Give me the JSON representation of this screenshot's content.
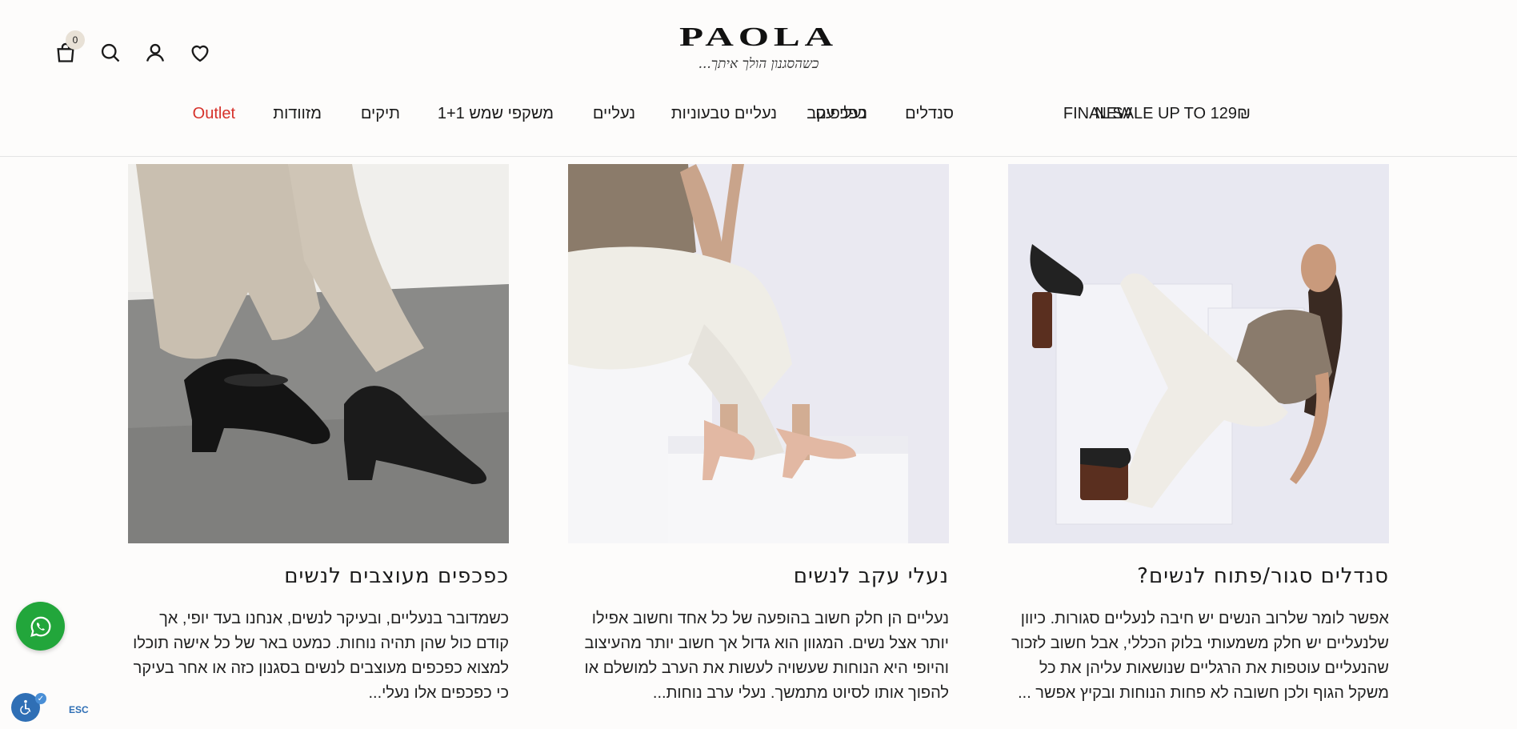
{
  "header": {
    "logo": {
      "word": "PAOLA",
      "tagline": "כשהסגנון הולך איתך..."
    },
    "cart_count": "0",
    "icons": [
      "cart-icon",
      "search-icon",
      "user-icon",
      "heart-icon"
    ]
  },
  "nav": {
    "items": [
      {
        "label": "NEW"
      },
      {
        "label": "FINAL SALE UP TO 129₪"
      },
      {
        "label": "נעלי עקב"
      },
      {
        "label": "סנדלים"
      },
      {
        "label": "כפכפים"
      },
      {
        "label": "נעליים טבעוניות"
      },
      {
        "label": "נעליים"
      },
      {
        "label": "משקפי שמש 1+1"
      },
      {
        "label": "תיקים"
      },
      {
        "label": "מזוודות"
      },
      {
        "label": "Outlet"
      }
    ],
    "outlet_color": "#d6322b"
  },
  "articles": [
    {
      "title": "סנדלים סגור/פתוח לנשים?",
      "excerpt": "אפשר לומר שלרוב הנשים יש חיבה לנעליים סגורות. כיוון שלנעליים יש חלק משמעותי בלוק הכללי, אבל חשוב לזכור שהנעליים עוטפות את הרגליים שנושאות עליהן את כל משקל הגוף ולכן חשובה לא פחות הנוחות ובקיץ אפשר ..."
    },
    {
      "title": "נעלי עקב לנשים",
      "excerpt": "נעליים הן חלק חשוב בהופעה של כל אחד וחשוב אפילו יותר אצל נשים. המגוון הוא גדול אך חשוב יותר מהעיצוב והיופי היא הנוחות שעשויה לעשות את הערב למושלם או להפוך אותו לסיוט מתמשך. נעלי ערב נוחות..."
    },
    {
      "title": "כפכפים מעוצבים לנשים",
      "excerpt": "כשמדובר בנעליים, ובעיקר לנשים, אנחנו בעד יופי, אך קודם כול שהן תהיה נוחות. כמעט באר של כל אישה תוכלו למצוא כפכפים מעוצבים לנשים בסגנון כזה או אחר בעיקר כי כפכפים אלו נעלי..."
    }
  ],
  "floating": {
    "esc_label": "ESC",
    "whatsapp_color": "#22a63b"
  }
}
